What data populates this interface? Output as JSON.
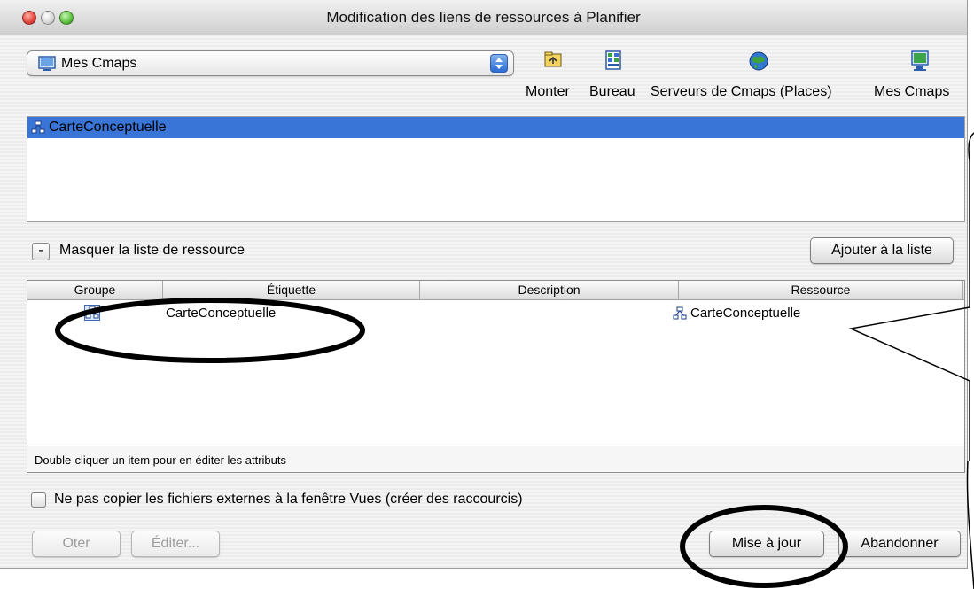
{
  "window": {
    "title": "Modification des liens de ressources à Planifier"
  },
  "location": {
    "selected": "Mes Cmaps"
  },
  "toolbar": {
    "monter": "Monter",
    "bureau": "Bureau",
    "serveurs": "Serveurs de Cmaps (Places)",
    "mes_cmaps": "Mes Cmaps"
  },
  "browser": {
    "items": [
      {
        "label": "CarteConceptuelle",
        "selected": true
      }
    ]
  },
  "resource_list": {
    "toggle_symbol": "-",
    "toggle_label": "Masquer la liste de ressource",
    "add_button": "Ajouter à la liste",
    "columns": [
      "Groupe",
      "Étiquette",
      "Description",
      "Ressource"
    ],
    "rows": [
      {
        "etiquette": "CarteConceptuelle",
        "description": "",
        "ressource": "CarteConceptuelle"
      }
    ],
    "status": "Double-cliquer un item pour en éditer les attributs"
  },
  "options": {
    "no_copy_label": "Ne pas copier les fichiers externes à la fenêtre Vues (créer des raccourcis)"
  },
  "buttons": {
    "oter": "Oter",
    "editer": "Éditer...",
    "mise_a_jour": "Mise à jour",
    "abandonner": "Abandonner"
  },
  "colors": {
    "selection": "#3875d7",
    "annotation": "#000000"
  }
}
